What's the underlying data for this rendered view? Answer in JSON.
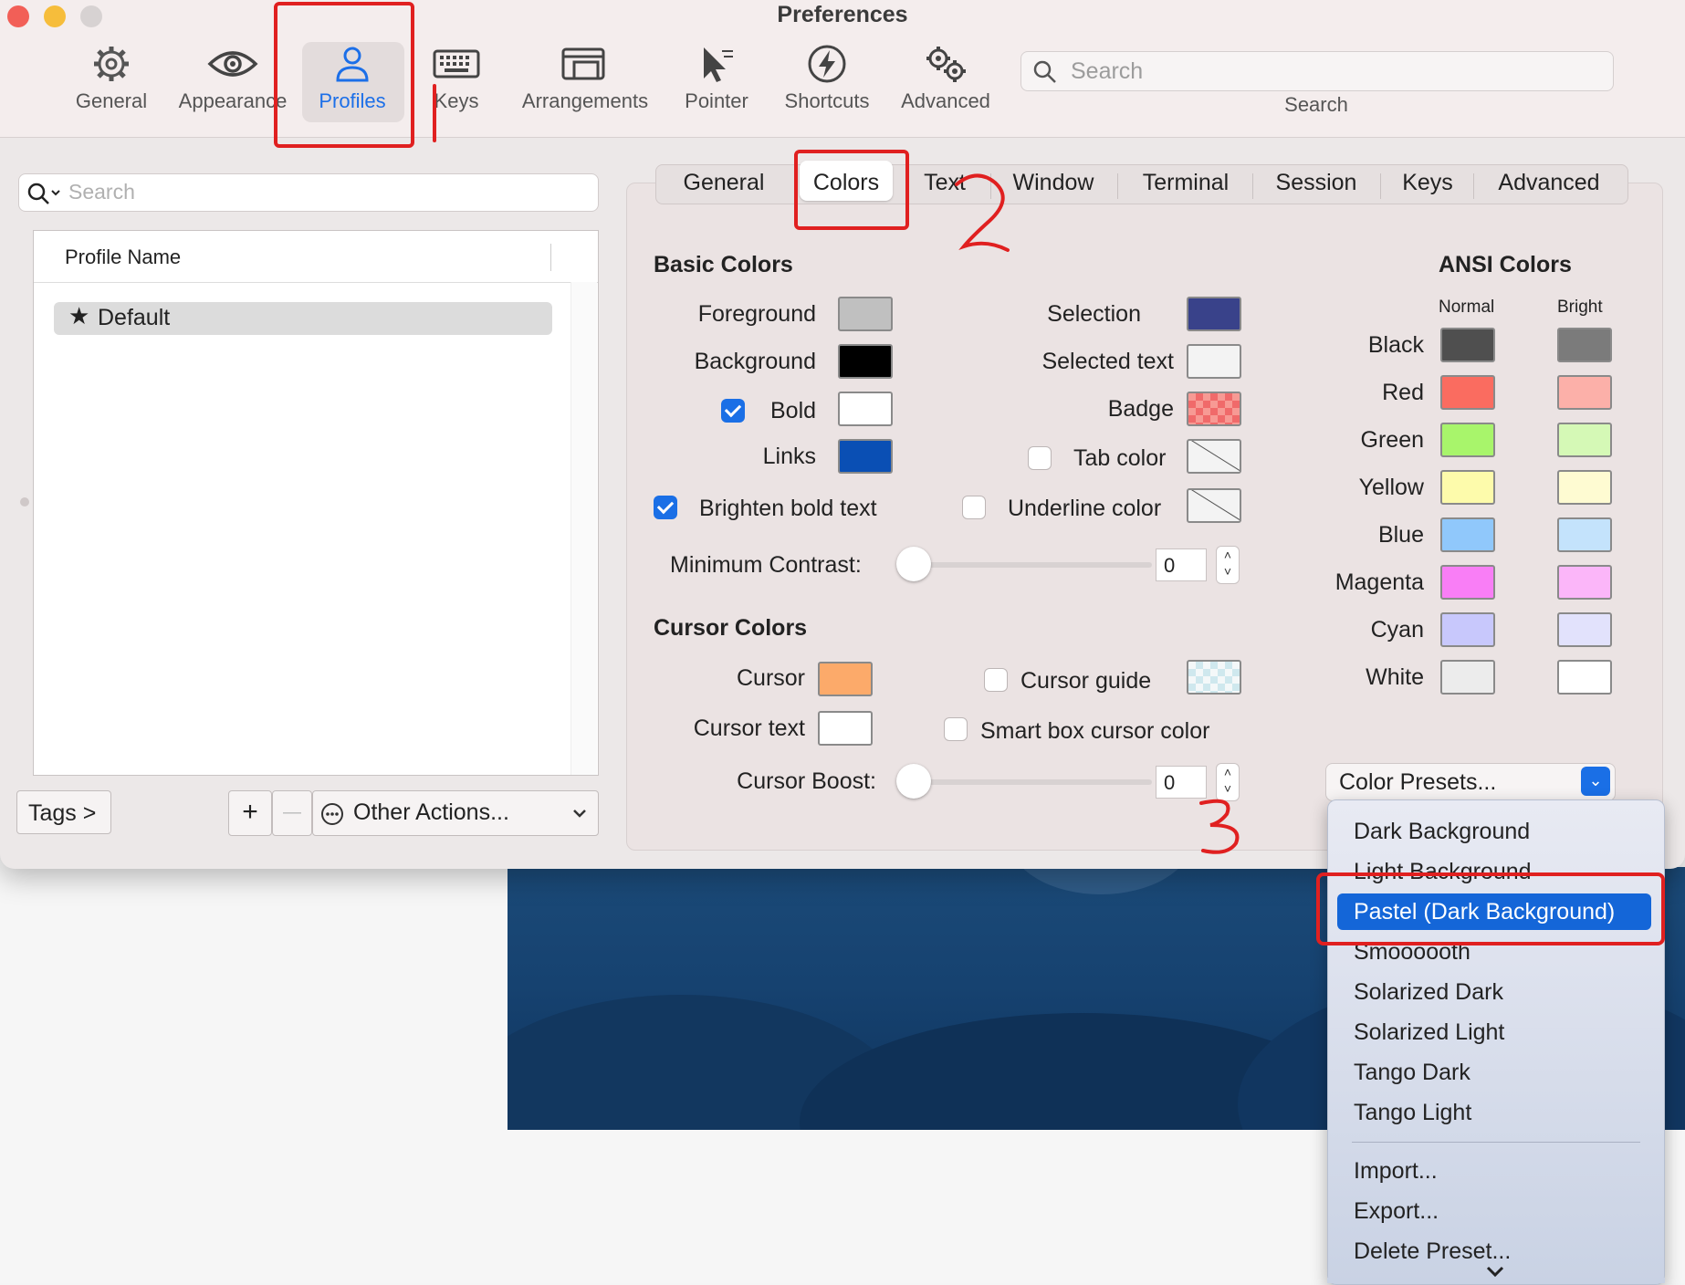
{
  "window": {
    "title": "Preferences"
  },
  "toolbar": {
    "items": [
      {
        "label": "General",
        "icon": "gear-icon"
      },
      {
        "label": "Appearance",
        "icon": "eye-icon"
      },
      {
        "label": "Profiles",
        "icon": "person-icon",
        "active": true
      },
      {
        "label": "Keys",
        "icon": "keyboard-icon"
      },
      {
        "label": "Arrangements",
        "icon": "window-icon"
      },
      {
        "label": "Pointer",
        "icon": "pointer-icon"
      },
      {
        "label": "Shortcuts",
        "icon": "bolt-icon"
      },
      {
        "label": "Advanced",
        "icon": "gears-icon"
      }
    ],
    "search_placeholder": "Search",
    "search_label": "Search"
  },
  "profiles": {
    "search_placeholder": "Search",
    "column_header": "Profile Name",
    "items": [
      {
        "name": "Default",
        "default": true
      }
    ],
    "tags_button": "Tags >",
    "add_button": "+",
    "remove_button": "—",
    "other_actions": "Other Actions..."
  },
  "tabs": [
    "General",
    "Colors",
    "Text",
    "Window",
    "Terminal",
    "Session",
    "Keys",
    "Advanced"
  ],
  "active_tab": "Colors",
  "basic_colors": {
    "title": "Basic Colors",
    "left": [
      {
        "label": "Foreground",
        "color": "#c0c0c0"
      },
      {
        "label": "Background",
        "color": "#000000"
      },
      {
        "label": "Bold",
        "color": "#ffffff",
        "checked": true
      },
      {
        "label": "Links",
        "color": "#0a4fb4"
      }
    ],
    "right": [
      {
        "label": "Selection",
        "color": "#39428a"
      },
      {
        "label": "Selected text",
        "color": "#f3f3f3"
      },
      {
        "label": "Badge",
        "color": "#f06a6a"
      },
      {
        "label": "Tab color",
        "color": "none",
        "checked": false
      },
      {
        "label": "Underline color",
        "color": "none",
        "checked": false
      }
    ],
    "brighten_bold": {
      "label": "Brighten bold text",
      "checked": true
    },
    "min_contrast": {
      "label": "Minimum Contrast:",
      "value": "0"
    }
  },
  "cursor_colors": {
    "title": "Cursor Colors",
    "cursor": {
      "label": "Cursor",
      "color": "#fcaa6a"
    },
    "cursor_text": {
      "label": "Cursor text",
      "color": "#ffffff"
    },
    "cursor_guide": {
      "label": "Cursor guide",
      "checked": false,
      "color": "#cfe8ee"
    },
    "smart_box": {
      "label": "Smart box cursor color",
      "checked": false
    },
    "boost": {
      "label": "Cursor Boost:",
      "value": "0"
    }
  },
  "ansi": {
    "title": "ANSI Colors",
    "normal_label": "Normal",
    "bright_label": "Bright",
    "rows": [
      {
        "name": "Black",
        "normal": "#4f4f4f",
        "bright": "#7b7b7b"
      },
      {
        "name": "Red",
        "normal": "#fa6c60",
        "bright": "#fcb0a9"
      },
      {
        "name": "Green",
        "normal": "#a8f56b",
        "bright": "#d5f9b6"
      },
      {
        "name": "Yellow",
        "normal": "#fdfbab",
        "bright": "#fefbd2"
      },
      {
        "name": "Blue",
        "normal": "#90c8fb",
        "bright": "#c4e3fc"
      },
      {
        "name": "Magenta",
        "normal": "#f97ef6",
        "bright": "#fbb6f9"
      },
      {
        "name": "Cyan",
        "normal": "#c8c8fc",
        "bright": "#e2e2fc"
      },
      {
        "name": "White",
        "normal": "#ececec",
        "bright": "#ffffff"
      }
    ]
  },
  "presets": {
    "button_label": "Color Presets...",
    "items": [
      "Dark Background",
      "Light Background",
      "Pastel (Dark Background)",
      "Smoooooth",
      "Solarized Dark",
      "Solarized Light",
      "Tango Dark",
      "Tango Light"
    ],
    "selected": "Pastel (Dark Background)",
    "actions": [
      "Import...",
      "Export...",
      "Delete Preset..."
    ]
  },
  "annotations": {
    "step1": "1",
    "step2": "2",
    "step3": "3"
  },
  "colors": {
    "accent": "#1a6fe6",
    "annotation": "#e02020"
  }
}
